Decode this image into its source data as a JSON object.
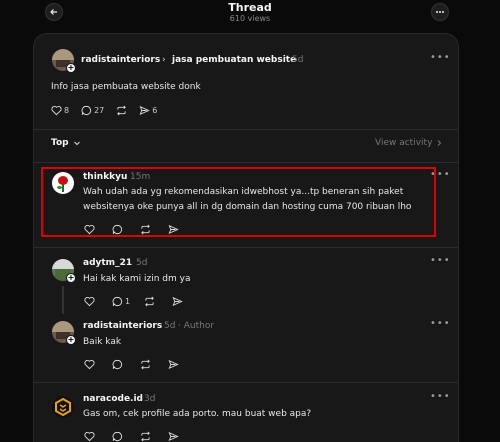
{
  "header": {
    "title": "Thread",
    "views": "610 views"
  },
  "original_post": {
    "username": "radistainteriors",
    "topic_separator": "›",
    "topic": "jasa pembuatan website",
    "time": "5d",
    "text": "Info jasa pembuata website donk",
    "likes": "8",
    "comments": "27",
    "shares": "6"
  },
  "sort": {
    "label": "Top",
    "view_activity": "View activity"
  },
  "replies": [
    {
      "username": "thinkkyu",
      "time": "15m",
      "text": "Wah udah ada yg rekomendasikan idwebhost ya...tp beneran sih paket websitenya oke punya all in dg domain dan hosting cuma 700 ribuan lho"
    },
    {
      "username": "adytm_21",
      "time": "5d",
      "text": "Hai kak kami izin dm ya",
      "comments": "1"
    },
    {
      "username": "radistainteriors",
      "time": "5d",
      "author_label": "· Author",
      "text": "Baik kak"
    },
    {
      "username": "naracode.id",
      "time": "3d",
      "text": "Gas om, cek profile ada porto. mau buat web apa?"
    }
  ],
  "icons": [
    "back-arrow-icon",
    "more-icon",
    "heart-icon",
    "comment-icon",
    "repost-icon",
    "send-icon",
    "chevron-down-icon",
    "chevron-right-icon"
  ],
  "colors": {
    "highlight": "#e00000",
    "background": "#0a0a0a",
    "panel": "#181818"
  }
}
